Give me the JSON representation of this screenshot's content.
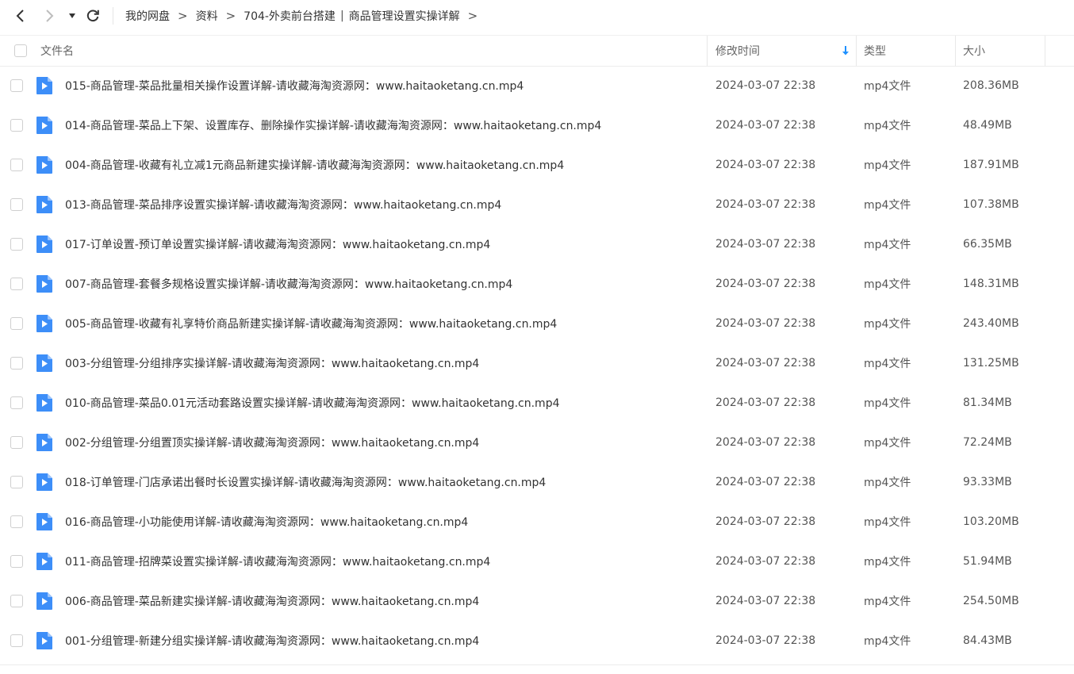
{
  "toolbar": {
    "back_icon": "chevron-left-icon",
    "forward_icon": "chevron-right-icon",
    "history_icon": "caret-down-icon",
    "refresh_icon": "refresh-icon"
  },
  "breadcrumb": {
    "items": [
      "我的网盘",
      "资料",
      "704-外卖前台搭建",
      "商品管理设置实操详解"
    ],
    "separator": ">",
    "pipe": "|"
  },
  "table": {
    "headers": {
      "name": "文件名",
      "modified": "修改时间",
      "type": "类型",
      "size": "大小"
    },
    "sort_icon": "sort-down-arrow-icon",
    "accent_color": "#1e90ff",
    "file_icon_color": "#3d8ef8",
    "rows": [
      {
        "name": "015-商品管理-菜品批量相关操作设置详解-请收藏海淘资源网：www.haitaoketang.cn.mp4",
        "modified": "2024-03-07 22:38",
        "type": "mp4文件",
        "size": "208.36MB"
      },
      {
        "name": "014-商品管理-菜品上下架、设置库存、删除操作实操详解-请收藏海淘资源网：www.haitaoketang.cn.mp4",
        "modified": "2024-03-07 22:38",
        "type": "mp4文件",
        "size": "48.49MB"
      },
      {
        "name": "004-商品管理-收藏有礼立减1元商品新建实操详解-请收藏海淘资源网：www.haitaoketang.cn.mp4",
        "modified": "2024-03-07 22:38",
        "type": "mp4文件",
        "size": "187.91MB"
      },
      {
        "name": "013-商品管理-菜品排序设置实操详解-请收藏海淘资源网：www.haitaoketang.cn.mp4",
        "modified": "2024-03-07 22:38",
        "type": "mp4文件",
        "size": "107.38MB"
      },
      {
        "name": "017-订单设置-预订单设置实操详解-请收藏海淘资源网：www.haitaoketang.cn.mp4",
        "modified": "2024-03-07 22:38",
        "type": "mp4文件",
        "size": "66.35MB"
      },
      {
        "name": "007-商品管理-套餐多规格设置实操详解-请收藏海淘资源网：www.haitaoketang.cn.mp4",
        "modified": "2024-03-07 22:38",
        "type": "mp4文件",
        "size": "148.31MB"
      },
      {
        "name": "005-商品管理-收藏有礼享特价商品新建实操详解-请收藏海淘资源网：www.haitaoketang.cn.mp4",
        "modified": "2024-03-07 22:38",
        "type": "mp4文件",
        "size": "243.40MB"
      },
      {
        "name": "003-分组管理-分组排序实操详解-请收藏海淘资源网：www.haitaoketang.cn.mp4",
        "modified": "2024-03-07 22:38",
        "type": "mp4文件",
        "size": "131.25MB"
      },
      {
        "name": "010-商品管理-菜品0.01元活动套路设置实操详解-请收藏海淘资源网：www.haitaoketang.cn.mp4",
        "modified": "2024-03-07 22:38",
        "type": "mp4文件",
        "size": "81.34MB"
      },
      {
        "name": "002-分组管理-分组置顶实操详解-请收藏海淘资源网：www.haitaoketang.cn.mp4",
        "modified": "2024-03-07 22:38",
        "type": "mp4文件",
        "size": "72.24MB"
      },
      {
        "name": "018-订单管理-门店承诺出餐时长设置实操详解-请收藏海淘资源网：www.haitaoketang.cn.mp4",
        "modified": "2024-03-07 22:38",
        "type": "mp4文件",
        "size": "93.33MB"
      },
      {
        "name": "016-商品管理-小功能使用详解-请收藏海淘资源网：www.haitaoketang.cn.mp4",
        "modified": "2024-03-07 22:38",
        "type": "mp4文件",
        "size": "103.20MB"
      },
      {
        "name": "011-商品管理-招牌菜设置实操详解-请收藏海淘资源网：www.haitaoketang.cn.mp4",
        "modified": "2024-03-07 22:38",
        "type": "mp4文件",
        "size": "51.94MB"
      },
      {
        "name": "006-商品管理-菜品新建实操详解-请收藏海淘资源网：www.haitaoketang.cn.mp4",
        "modified": "2024-03-07 22:38",
        "type": "mp4文件",
        "size": "254.50MB"
      },
      {
        "name": "001-分组管理-新建分组实操详解-请收藏海淘资源网：www.haitaoketang.cn.mp4",
        "modified": "2024-03-07 22:38",
        "type": "mp4文件",
        "size": "84.43MB"
      }
    ]
  }
}
